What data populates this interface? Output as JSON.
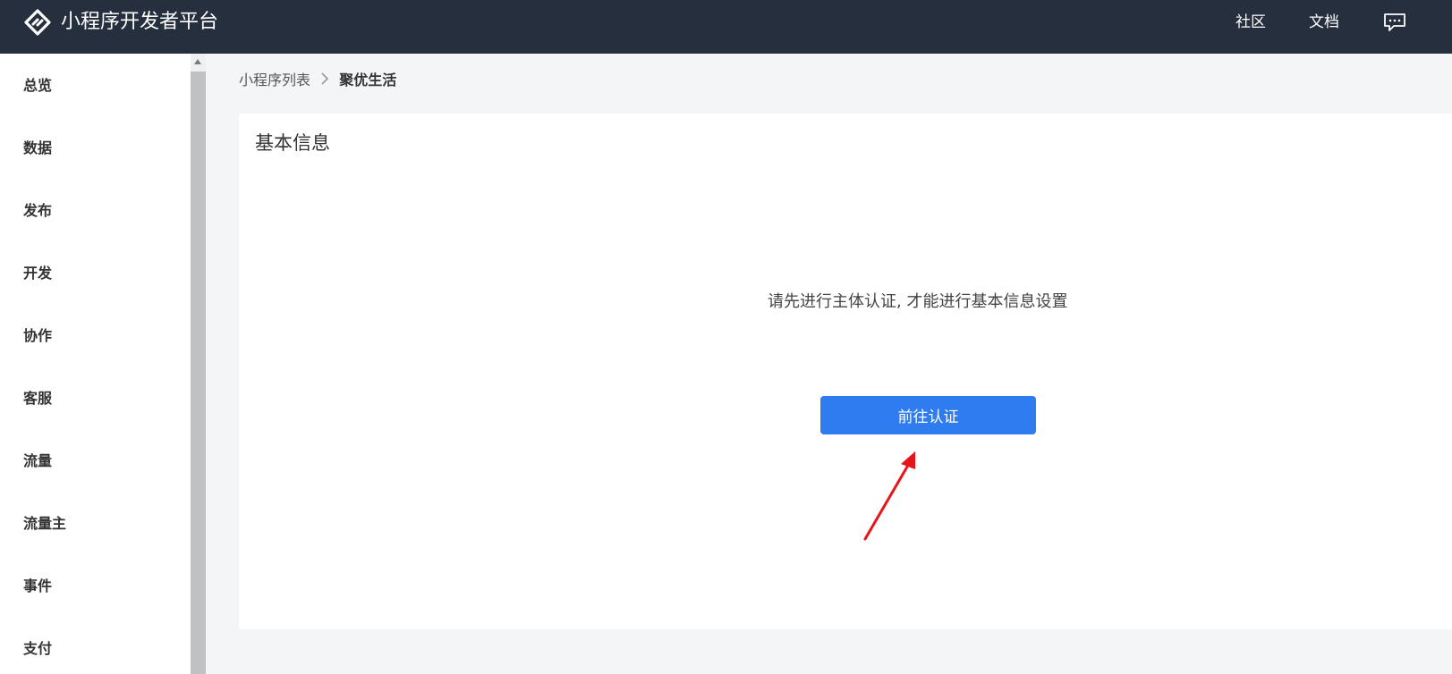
{
  "header": {
    "title": "小程序开发者平台",
    "logo_icon": "link-chain-icon",
    "nav": [
      {
        "label": "社区"
      },
      {
        "label": "文档"
      }
    ],
    "message_icon": "message-icon"
  },
  "sidebar": {
    "items": [
      {
        "label": "总览"
      },
      {
        "label": "数据"
      },
      {
        "label": "发布"
      },
      {
        "label": "开发"
      },
      {
        "label": "协作"
      },
      {
        "label": "客服"
      },
      {
        "label": "流量"
      },
      {
        "label": "流量主"
      },
      {
        "label": "事件"
      },
      {
        "label": "支付"
      }
    ]
  },
  "breadcrumb": {
    "parent": "小程序列表",
    "current": "聚优生活"
  },
  "card": {
    "title": "基本信息",
    "notice": "请先进行主体认证, 才能进行基本信息设置",
    "button_label": "前往认证"
  },
  "colors": {
    "topbar": "#252f3e",
    "primary_button": "#2f7bf0",
    "annotation_arrow": "#e8141a"
  }
}
